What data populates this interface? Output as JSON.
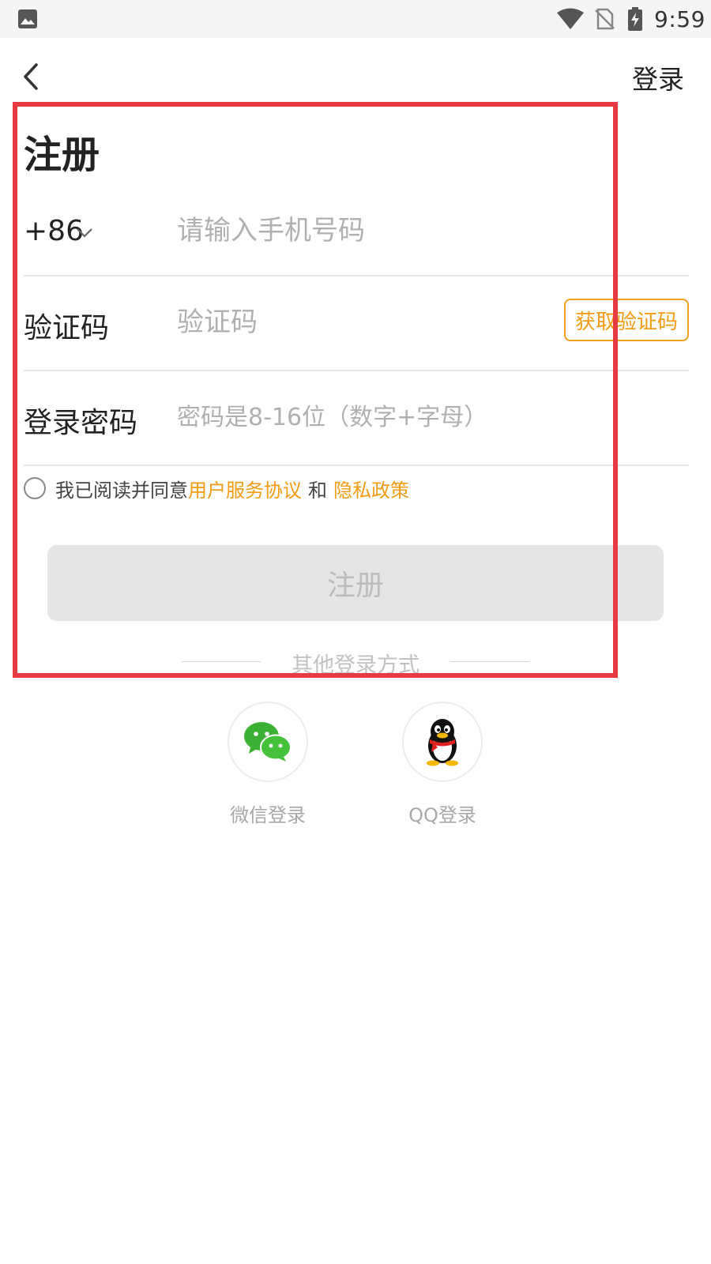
{
  "status_bar": {
    "time": "9:59",
    "icons": [
      "gallery-icon",
      "wifi-icon",
      "no-sim-icon",
      "battery-charging-icon"
    ]
  },
  "header": {
    "back_icon": "chevron-left-icon",
    "login_label": "登录"
  },
  "page_title": "注册",
  "form": {
    "phone": {
      "country_code": "+86",
      "placeholder": "请输入手机号码",
      "value": ""
    },
    "verify_code": {
      "label": "验证码",
      "placeholder": "验证码",
      "value": "",
      "get_code_label": "获取验证码"
    },
    "password": {
      "label": "登录密码",
      "placeholder": "密码是8-16位（数字+字母）",
      "value": ""
    }
  },
  "agreement": {
    "prefix": "我已阅读并同意",
    "terms_link": "用户服务协议",
    "and": "和",
    "privacy_link": "隐私政策",
    "checked": false
  },
  "register_button": "注册",
  "other_login": {
    "title": "其他登录方式",
    "methods": [
      {
        "label": "微信登录",
        "icon": "wechat-icon"
      },
      {
        "label": "QQ登录",
        "icon": "qq-icon"
      }
    ]
  },
  "colors": {
    "accent": "#f39b12",
    "highlight": "#e63b43",
    "wechat": "#3cb034"
  }
}
